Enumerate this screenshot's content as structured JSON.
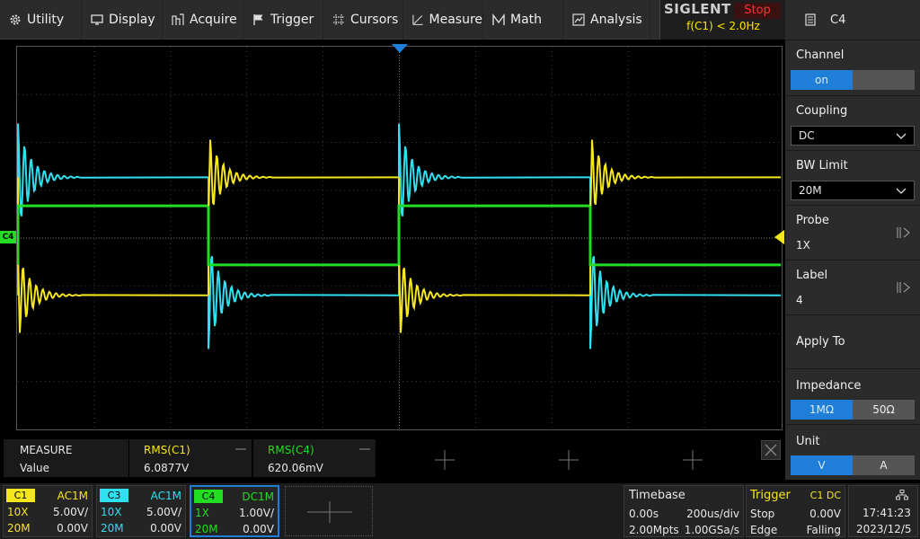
{
  "menu": [
    {
      "label": "Utility",
      "icon": "gear-icon"
    },
    {
      "label": "Display",
      "icon": "monitor-icon"
    },
    {
      "label": "Acquire",
      "icon": "acquire-icon"
    },
    {
      "label": "Trigger",
      "icon": "flag-icon"
    },
    {
      "label": "Cursors",
      "icon": "crosshair-icon"
    },
    {
      "label": "Measure",
      "icon": "measure-icon"
    },
    {
      "label": "Math",
      "icon": "math-icon"
    },
    {
      "label": "Analysis",
      "icon": "analysis-icon"
    }
  ],
  "brand": {
    "logo": "SIGLENT",
    "state": "Stop",
    "trigger_freq": "f(C1) < 2.0Hz"
  },
  "panel": {
    "title": "C4",
    "channel": {
      "title": "Channel",
      "on": "on",
      "off": ""
    },
    "coupling": {
      "title": "Coupling",
      "value": "DC"
    },
    "bw_limit": {
      "title": "BW Limit",
      "value": "20M"
    },
    "probe": {
      "title": "Probe",
      "value": "1X"
    },
    "label": {
      "title": "Label",
      "value": "4"
    },
    "apply_to": {
      "title": "Apply To"
    },
    "impedance": {
      "title": "Impedance",
      "on": "1MΩ",
      "off": "50Ω"
    },
    "unit": {
      "title": "Unit",
      "on": "V",
      "off": "A"
    }
  },
  "measure": {
    "header": "MEASURE",
    "row_label": "Value",
    "items": [
      {
        "name": "RMS(C1)",
        "value": "6.0877V"
      },
      {
        "name": "RMS(C4)",
        "value": "620.06mV"
      }
    ]
  },
  "channels": [
    {
      "tag": "C1",
      "coupling": "AC1M",
      "probe": "10X",
      "scale": "5.00V/",
      "bw": "20M",
      "offset": "0.00V"
    },
    {
      "tag": "C3",
      "coupling": "AC1M",
      "probe": "10X",
      "scale": "5.00V/",
      "bw": "20M",
      "offset": "0.00V"
    },
    {
      "tag": "C4",
      "coupling": "DC1M",
      "probe": "1X",
      "scale": "1.00V/",
      "bw": "20M",
      "offset": "0.00V"
    }
  ],
  "timebase": {
    "title": "Timebase",
    "delay": "0.00s",
    "scale": "200us/div",
    "memory": "2.00Mpts",
    "rate": "1.00GSa/s"
  },
  "trigger": {
    "title": "Trigger",
    "source": "C1 DC",
    "mode": "Stop",
    "level": "0.00V",
    "type": "Edge",
    "slope": "Falling"
  },
  "clock": {
    "time": "17:41:23",
    "date": "2023/12/5"
  },
  "colors": {
    "c1": "#f5e61d",
    "c3": "#2ee0f0",
    "c4": "#22dd22",
    "accent": "#1e7ed8",
    "stop": "#ff3030"
  },
  "marker_c4": "C4"
}
